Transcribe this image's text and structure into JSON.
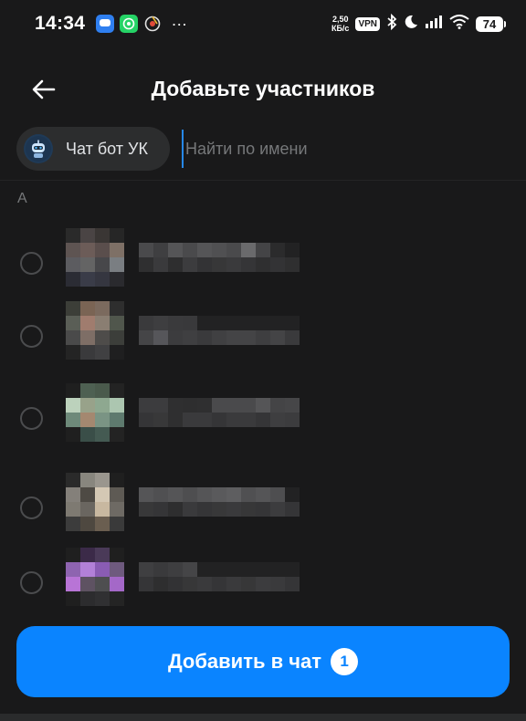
{
  "status_bar": {
    "time": "14:34",
    "net_speed_value": "2,50",
    "net_speed_unit": "КБ/с",
    "vpn_label": "VPN",
    "battery": "74",
    "app_icons": [
      "chat-bubble-icon",
      "whatsapp-icon",
      "chrome-icon"
    ]
  },
  "header": {
    "title": "Добавьте участников",
    "back_icon": "arrow-left-icon"
  },
  "selected": {
    "chips": [
      {
        "label": "Чат бот УК",
        "icon": "robot-avatar-icon"
      }
    ]
  },
  "search": {
    "placeholder": "Найти по имени",
    "value": ""
  },
  "section": {
    "letter": "А"
  },
  "contacts": [
    {
      "selected": false,
      "avatar": [
        "#2a2a2a",
        "#4a4444",
        "#3a3634",
        "#262626",
        "#5e5452",
        "#6c5c58",
        "#5a4e4c",
        "#7e7066",
        "#5c5c60",
        "#646464",
        "#47474a",
        "#7a7e82",
        "#2b2c34",
        "#3a3c48",
        "#353640",
        "#2a2a2e"
      ],
      "name": [
        "#4a4a4c",
        "#3f3f41",
        "#555557",
        "#4a4a4c",
        "#555557",
        "#505052",
        "#4a4a4c",
        "#6a6a6c",
        "#444446",
        "#2b2b2c",
        "#222223",
        "#2f2f30",
        "#3a3a3c",
        "#2e2e2f",
        "#3c3c3e",
        "#333335",
        "#373738",
        "#3a3a3c",
        "#353537",
        "#2f2f30",
        "#333335",
        "#2f2f30"
      ]
    },
    {
      "selected": false,
      "avatar": [
        "#3c3e38",
        "#7a6454",
        "#7b6a5e",
        "#2e2e2e",
        "#5a5e56",
        "#a07c6e",
        "#8a7e72",
        "#50564c",
        "#4a4a4a",
        "#7e6e66",
        "#4e4c4a",
        "#3c3e3a",
        "#242424",
        "#3a3a3c",
        "#404042",
        "#1f1f20"
      ],
      "name": [
        "#3a3a3c",
        "#3e3e40",
        "#3a3a3c",
        "#39393b",
        "#222223",
        "#222223",
        "#222223",
        "#222223",
        "#222223",
        "#222223",
        "#222223",
        "#454547",
        "#56565a",
        "#3c3c3e",
        "#3f3f41",
        "#3a3a3c",
        "#404042",
        "#444446",
        "#444446",
        "#3e3e40",
        "#444446",
        "#3a3a3c"
      ]
    },
    {
      "selected": false,
      "avatar": [
        "#1f1f1f",
        "#4e6052",
        "#4a5a4c",
        "#232323",
        "#bcd2bc",
        "#98a28a",
        "#8ea890",
        "#acc6b0",
        "#6e8a7a",
        "#a48870",
        "#7a9484",
        "#5e7a6e",
        "#1f1f1f",
        "#3a4e48",
        "#445a52",
        "#232323"
      ],
      "name": [
        "#3c3c3e",
        "#3c3c3e",
        "#2f2f30",
        "#2e2e2f",
        "#2f2f30",
        "#4a4a4c",
        "#4a4a4c",
        "#4a4a4c",
        "#555557",
        "#444446",
        "#464648",
        "#353537",
        "#383839",
        "#2f2f30",
        "#3a3a3c",
        "#3a3a3c",
        "#353537",
        "#3a3a3c",
        "#3a3a3c",
        "#353537",
        "#3e3e40",
        "#3c3c3e"
      ]
    },
    {
      "selected": false,
      "avatar": [
        "#2a2a2a",
        "#88867e",
        "#9a968e",
        "#1f1f1f",
        "#84807a",
        "#4e4a44",
        "#d4c8b4",
        "#5e5a54",
        "#7e7a72",
        "#6a6660",
        "#c8b8a0",
        "#6e6a64",
        "#3c3c3c",
        "#4e4840",
        "#6a5e50",
        "#3a3a3a"
      ],
      "name": [
        "#555557",
        "#505052",
        "#555557",
        "#4e4e50",
        "#555557",
        "#5a5a5c",
        "#5e5e60",
        "#505052",
        "#555557",
        "#4e4e50",
        "#222223",
        "#383839",
        "#353537",
        "#2e2e2f",
        "#3a3a3c",
        "#353537",
        "#383839",
        "#3a3a3c",
        "#373738",
        "#353537",
        "#3c3c3e",
        "#353537"
      ]
    },
    {
      "selected": false,
      "avatar": [
        "#1f1f1f",
        "#3b2a48",
        "#4a3a58",
        "#1f1f1f",
        "#8e64b0",
        "#b280d8",
        "#8a5cb4",
        "#6e5a7e",
        "#b874d6",
        "#5e5262",
        "#4e4e50",
        "#a468c8",
        "#1f1f1f",
        "#2c2c2e",
        "#303032",
        "#242424"
      ],
      "name": [
        "#3f3f41",
        "#3a3a3c",
        "#3e3e40",
        "#454547",
        "#222223",
        "#222223",
        "#222223",
        "#222223",
        "#222223",
        "#222223",
        "#222223",
        "#353537",
        "#2e2e2f",
        "#323234",
        "#373738",
        "#3a3a3c",
        "#353537",
        "#3a3a3c",
        "#373738",
        "#3c3c3e",
        "#3a3a3c",
        "#353537"
      ]
    }
  ],
  "footer": {
    "button_label": "Добавить в чат",
    "count": "1"
  },
  "colors": {
    "background": "#19191a",
    "accent": "#0a84ff",
    "chip_bg": "#2c2d2e",
    "placeholder": "#76787a"
  }
}
